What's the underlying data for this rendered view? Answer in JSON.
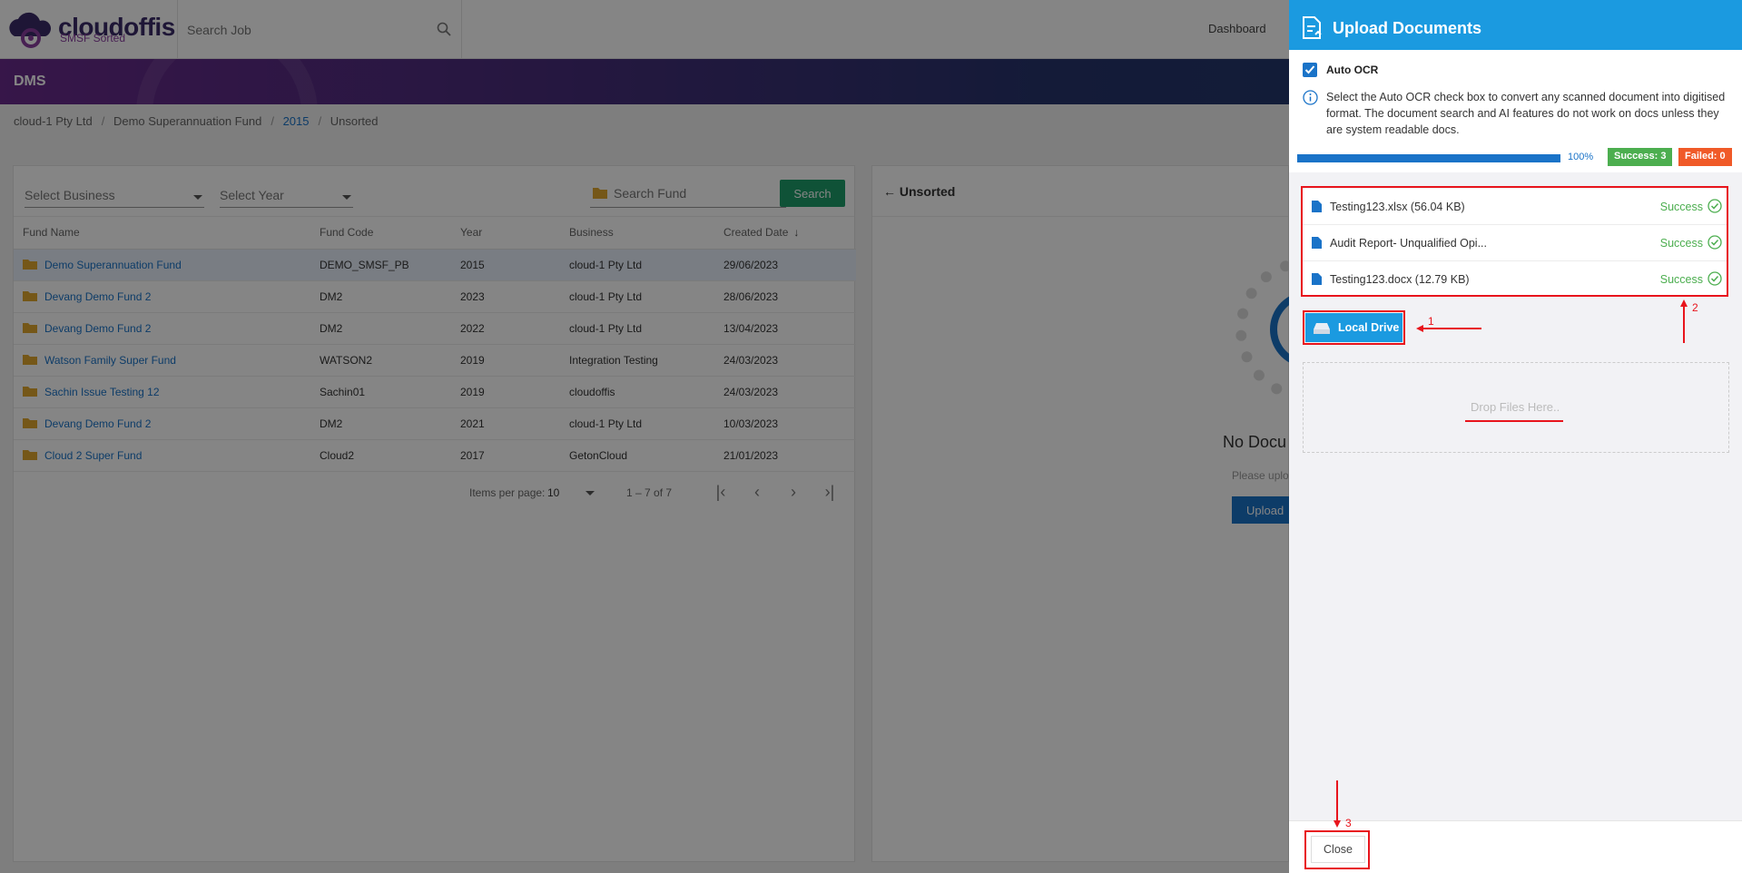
{
  "app": {
    "logo_name": "cloudoffis",
    "logo_tagline": "SMSF Sorted",
    "search_placeholder": "Search Job",
    "nav_dashboard": "Dashboard",
    "section_title": "DMS"
  },
  "breadcrumb": [
    "cloud-1 Pty Ltd",
    "Demo Superannuation Fund",
    "2015",
    "Unsorted"
  ],
  "filters": {
    "business_placeholder": "Select Business",
    "year_placeholder": "Select Year",
    "fund_placeholder": "Search Fund",
    "search_label": "Search"
  },
  "table": {
    "columns": [
      "Fund Name",
      "Fund Code",
      "Year",
      "Business",
      "Created Date"
    ],
    "rows": [
      {
        "name": "Demo Superannuation Fund",
        "code": "DEMO_SMSF_PB",
        "year": "2015",
        "business": "cloud-1 Pty Ltd",
        "date": "29/06/2023"
      },
      {
        "name": "Devang Demo Fund 2",
        "code": "DM2",
        "year": "2023",
        "business": "cloud-1 Pty Ltd",
        "date": "28/06/2023"
      },
      {
        "name": "Devang Demo Fund 2",
        "code": "DM2",
        "year": "2022",
        "business": "cloud-1 Pty Ltd",
        "date": "13/04/2023"
      },
      {
        "name": "Watson Family Super Fund",
        "code": "WATSON2",
        "year": "2019",
        "business": "Integration Testing",
        "date": "24/03/2023"
      },
      {
        "name": "Sachin Issue Testing 12",
        "code": "Sachin01",
        "year": "2019",
        "business": "cloudoffis",
        "date": "24/03/2023"
      },
      {
        "name": "Devang Demo Fund 2",
        "code": "DM2",
        "year": "2021",
        "business": "cloud-1 Pty Ltd",
        "date": "10/03/2023"
      },
      {
        "name": "Cloud 2 Super Fund",
        "code": "Cloud2",
        "year": "2017",
        "business": "GetonCloud",
        "date": "21/01/2023"
      }
    ]
  },
  "pager": {
    "items_per_page_label": "Items per page:",
    "items_per_page": "10",
    "range": "1 – 7 of 7"
  },
  "middle": {
    "back_label": "Unsorted",
    "no_doc": "No Docu",
    "please": "Please uplo",
    "upload_btn": "Upload"
  },
  "drawer": {
    "title": "Upload Documents",
    "auto_ocr_label": "Auto OCR",
    "auto_ocr_checked": true,
    "info": "Select the Auto OCR check box to convert any scanned document into digitised format. The document search and AI features do not work on docs unless they are system readable docs.",
    "progress_pct": 100,
    "progress_label": "100%",
    "success_badge": "Success: 3",
    "failed_badge": "Failed: 0",
    "files": [
      {
        "name": "Testing123.xlsx (56.04 KB)",
        "status": "Success"
      },
      {
        "name": "Audit Report- Unqualified Opi...",
        "status": "Success"
      },
      {
        "name": "Testing123.docx (12.79 KB)",
        "status": "Success"
      }
    ],
    "local_drive_label": "Local Drive",
    "drop_text": "Drop Files Here..",
    "close_label": "Close"
  },
  "annotations": [
    "1",
    "2",
    "3"
  ],
  "colors": {
    "accent": "#1b9ae0",
    "primary": "#1a73c8",
    "success": "#4cae4f",
    "failed": "#f05a28",
    "annotation": "#e8141c",
    "search_button": "#1e9e6a"
  }
}
